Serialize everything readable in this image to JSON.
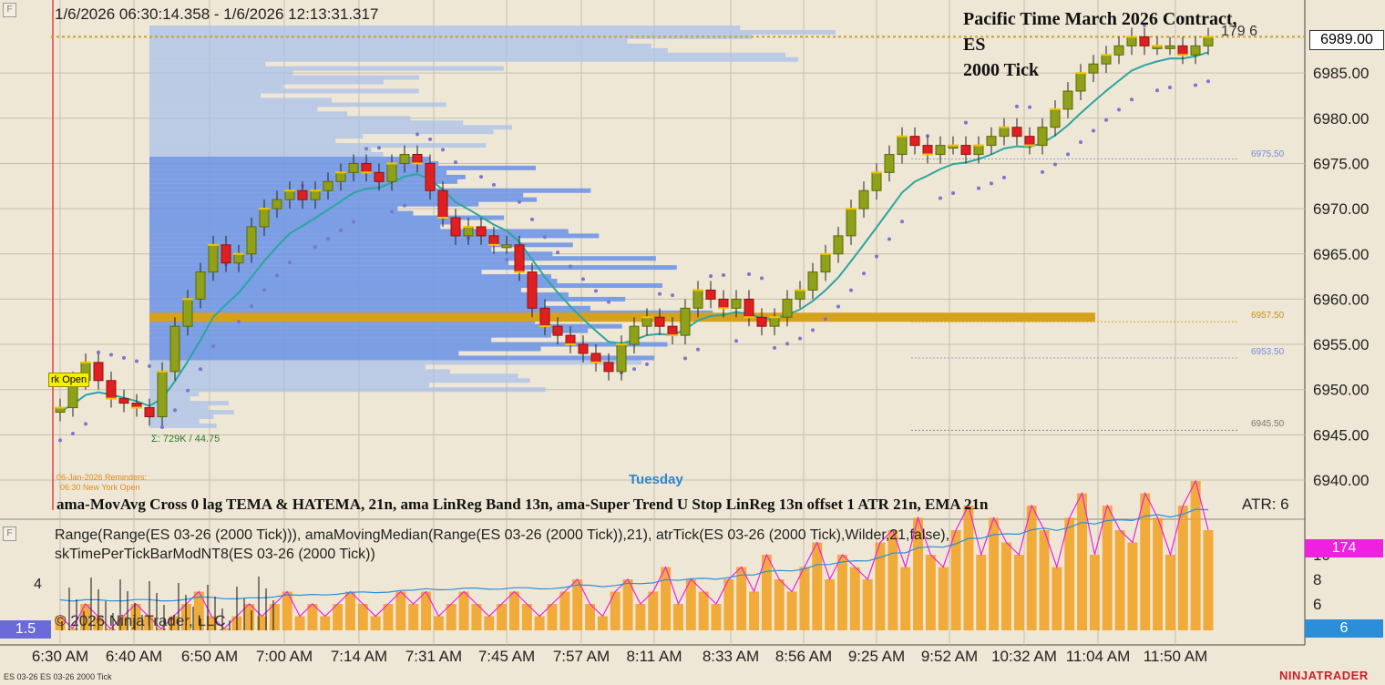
{
  "header": {
    "date_range": "1/6/2026 06:30:14.358 - 1/6/2026 12:13:31.317",
    "chart_title_line1": "Pacific Time March 2026 Contract,",
    "chart_title_line2": "ES",
    "chart_title_line3": "2000 Tick",
    "bar_counter": "179  6"
  },
  "annotations": {
    "session_label": "rk Open",
    "reminder_line1": "06-Jan-2026 Reminders:",
    "reminder_line2": "06:30 New York Open",
    "volume_summary": "Σ: 729K / 44.75",
    "day_label": "Tuesday",
    "indicator_legend": "ama-MovAvg Cross  0 lag TEMA & HATEMA, 21n,  ama LinReg Band 13n, ama-Super Trend U Stop LinReg  13n offset  1 ATR 21n, EMA 21n",
    "atr_label": "ATR: 6",
    "level_1": "6975.50",
    "level_2": "6957.50",
    "level_3": "6953.50",
    "level_4": "6945.50",
    "current_price": "6989.00",
    "copyright": "© 2026 NinjaTrader, LLC",
    "footer_instrument": "ES 03-26 ES 03-26 2000 Tick",
    "brand": "NINJATRADER"
  },
  "lower_panel": {
    "legend_line1": "Range(Range(ES 03-26 (2000 Tick))), amaMovingMedian(Range(ES 03-26 (2000 Tick)),21), atrTick(ES 03-26 (2000 Tick),Wilder,21,false),",
    "legend_line2": "skTimePerTickBarModNT8(ES 03-26 (2000 Tick))",
    "left_value": "1.5",
    "range_tag": "174",
    "atr_tag": "6",
    "left_tick_4": "4"
  },
  "colors": {
    "background": "#efe7d5",
    "up_bar": "#8fa01a",
    "down_bar": "#e02020",
    "ema": "#2aa6a0",
    "supertrend": "#7b74d0",
    "profile": "#6f96e6",
    "poc": "#d6a21e",
    "magenta_tag": "#f020e0",
    "blue_tag": "#2a8fd8"
  },
  "chart_data": [
    {
      "type": "line",
      "title": "Pacific Time March 2026 Contract, ES 2000 Tick",
      "subtitle": "1/6/2026 06:30:14.358 - 1/6/2026 12:13:31.317",
      "x_tick_labels": [
        "6:30 AM",
        "6:40 AM",
        "6:50 AM",
        "7:00 AM",
        "7:14 AM",
        "7:31 AM",
        "7:45 AM",
        "7:57 AM",
        "8:11 AM",
        "8:33 AM",
        "8:56 AM",
        "9:25 AM",
        "9:52 AM",
        "10:32 AM",
        "11:04 AM",
        "11:50 AM"
      ],
      "y_tick_labels": [
        "6940.00",
        "6945.00",
        "6950.00",
        "6955.00",
        "6960.00",
        "6965.00",
        "6970.00",
        "6975.00",
        "6980.00",
        "6985.00",
        "6989.00"
      ],
      "ylim": [
        6937.5,
        6991
      ],
      "grid": true,
      "series": [
        {
          "values": [
            6948,
            6951,
            6953,
            6951,
            6949,
            6948.5,
            6948,
            6947,
            6952,
            6957,
            6960,
            6963,
            6966,
            6964,
            6965,
            6968,
            6970,
            6971,
            6972,
            6971,
            6972,
            6973,
            6974,
            6975,
            6974,
            6973,
            6975,
            6976,
            6975,
            6972,
            6969,
            6967,
            6968,
            6967,
            6966,
            6966,
            6963,
            6959,
            6957,
            6956,
            6955,
            6954,
            6953,
            6952,
            6955,
            6957,
            6958,
            6957,
            6956,
            6959,
            6961,
            6960,
            6959,
            6960,
            6958,
            6957,
            6958,
            6960,
            6961,
            6963,
            6965,
            6967,
            6970,
            6972,
            6974,
            6976,
            6978,
            6977,
            6976,
            6977,
            6977,
            6976,
            6977,
            6978,
            6979,
            6978,
            6977,
            6979,
            6981,
            6983,
            6985,
            6986,
            6987,
            6988,
            6989,
            6988,
            6988,
            6988,
            6987,
            6988,
            6989
          ]
        }
      ]
    },
    {
      "type": "bar",
      "title": "Range / amaMovingMedian / atrTick / skTimePerTickBarModNT8",
      "y_tick_labels": [
        "4",
        "6",
        "8",
        "10"
      ],
      "ylim": [
        2,
        14
      ],
      "series": [
        {
          "values": [
            5,
            4,
            6,
            5,
            4,
            5,
            6,
            5,
            4,
            5,
            6,
            7,
            5,
            4,
            5,
            6,
            5,
            6,
            7,
            5,
            6,
            5,
            6,
            7,
            6,
            5,
            6,
            7,
            6,
            7,
            5,
            6,
            7,
            6,
            5,
            6,
            7,
            6,
            5,
            6,
            7,
            8,
            6,
            5,
            7,
            8,
            6,
            7,
            9,
            6,
            8,
            7,
            6,
            8,
            9,
            7,
            10,
            8,
            7,
            9,
            11,
            8,
            10,
            9,
            8,
            11,
            12,
            9,
            13,
            10,
            9,
            12,
            14,
            10,
            13,
            11,
            10,
            14,
            12,
            9,
            13,
            15,
            10,
            14,
            12,
            11,
            15,
            13,
            10,
            14,
            16,
            12
          ]
        }
      ]
    }
  ]
}
